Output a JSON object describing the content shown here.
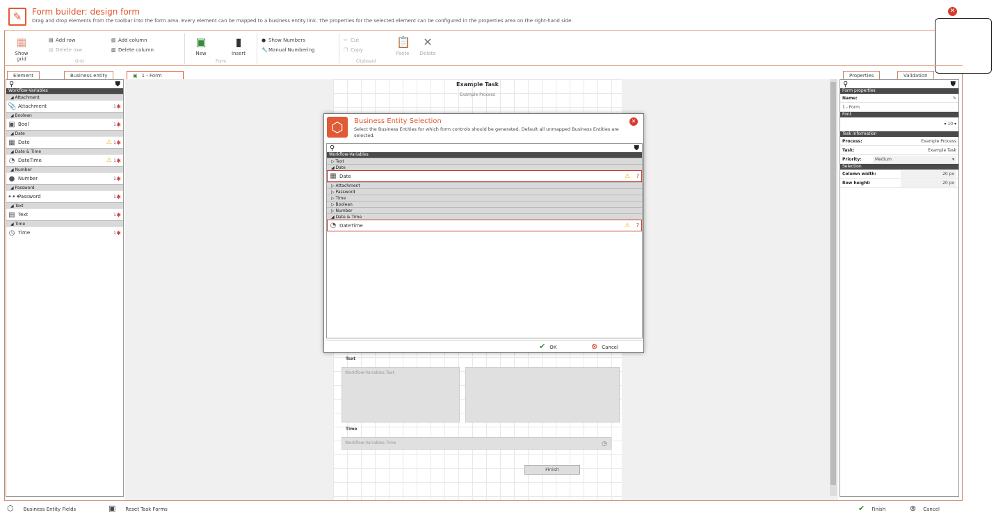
{
  "window": {
    "title": "Form builder: design form",
    "subtitle": "Drag and drop elements from the toolbar into the form area. Every element can be mapped to a business entity link. The properties for the selected element can be configured in the properties area on the right-hand side."
  },
  "ribbon": {
    "show_grid": "Show grid",
    "add_row": "Add row",
    "delete_row": "Delete row",
    "add_column": "Add column",
    "delete_column": "Delete column",
    "grid_group": "Grid",
    "new": "New",
    "insert": "Insert",
    "form_group": "Form",
    "show_numbers": "Show Numbers",
    "manual_numbering": "Manual Numbering",
    "cut": "Cut",
    "copy": "Copy",
    "paste": "Paste",
    "delete": "Delete",
    "clipboard_group": "Clipboard"
  },
  "tabs": {
    "element": "Element",
    "business_entity": "Business entity",
    "form": "1 - Form",
    "properties": "Properties",
    "validation": "Validation"
  },
  "left_panel": {
    "root": "Workflow-Variables",
    "groups": [
      {
        "label": "Attachment",
        "item": "Attachment",
        "icon": "📎",
        "num": "1",
        "warn": false
      },
      {
        "label": "Boolean",
        "item": "Bool",
        "icon": "▣",
        "num": "1",
        "warn": false
      },
      {
        "label": "Date",
        "item": "Date",
        "icon": "▦",
        "num": "1",
        "warn": true
      },
      {
        "label": "Date & Time",
        "item": "DateTime",
        "icon": "◔",
        "num": "1",
        "warn": true
      },
      {
        "label": "Number",
        "item": "Number",
        "icon": "●",
        "num": "1",
        "warn": false
      },
      {
        "label": "Password",
        "item": "Password",
        "icon": "•••",
        "num": "1",
        "warn": false
      },
      {
        "label": "Text",
        "item": "Text",
        "icon": "▤",
        "num": "1",
        "warn": false
      },
      {
        "label": "Time",
        "item": "Time",
        "icon": "◷",
        "num": "1",
        "warn": false
      }
    ]
  },
  "form": {
    "title": "Example Task",
    "subtitle": "Example Process",
    "text_label": "Text",
    "text_placeholder": "Workflow-Variables.Text",
    "time_label": "Time",
    "time_placeholder": "Workflow-Variables.Time",
    "finish_button": "Finish"
  },
  "dialog": {
    "title": "Business Entity Selection",
    "description": "Select the Business Entities for which form controls should be generated. Default all unmapped Business Entities are selected.",
    "root": "Workflow-Variables",
    "rows": {
      "text": "Text",
      "date_group": "Date",
      "date_item": "Date",
      "attachment": "Attachment",
      "password": "Password",
      "time": "Time",
      "boolean": "Boolean",
      "number": "Number",
      "datetime_group": "Date & Time",
      "datetime_item": "DateTime"
    },
    "ok": "OK",
    "cancel": "Cancel"
  },
  "properties": {
    "form_properties": "Form properties",
    "name_label": "Name:",
    "name_value": "1 - Form",
    "font_header": "Font",
    "font_size": "10",
    "task_info": "Task information",
    "process_label": "Process:",
    "process_value": "Example Process",
    "task_label": "Task:",
    "task_value": "Example Task",
    "priority_label": "Priority:",
    "priority_value": "Medium",
    "selection": "Selection",
    "col_width_label": "Column width:",
    "col_width_value": "20 px",
    "row_height_label": "Row height:",
    "row_height_value": "20 px"
  },
  "statusbar": {
    "business_entity_fields": "Business Entity Fields",
    "reset_task_forms": "Reset Task Forms",
    "finish": "Finish",
    "cancel": "Cancel"
  },
  "colors": {
    "accent": "#e2542b",
    "close": "#d43c2e",
    "warning": "#e5b000"
  }
}
